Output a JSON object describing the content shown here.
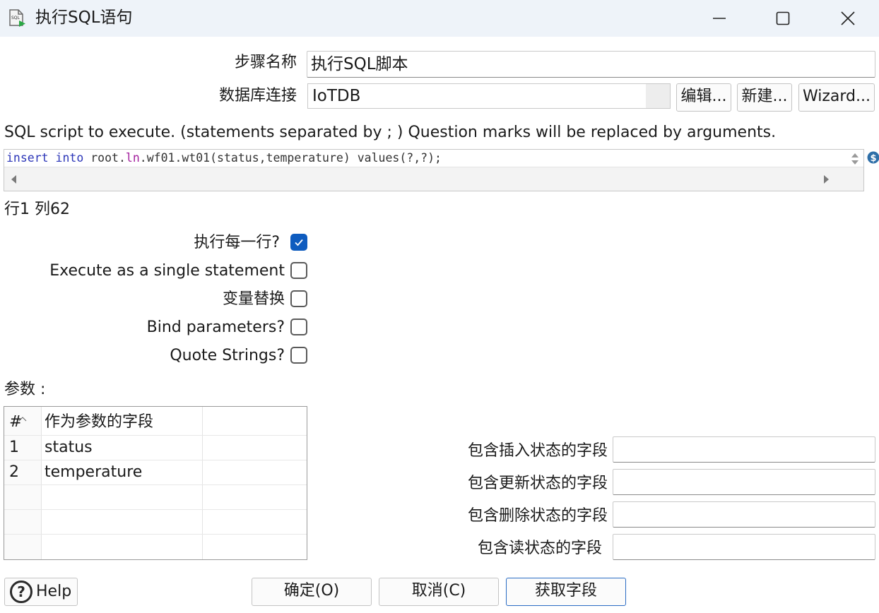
{
  "window": {
    "title": "执行SQL语句",
    "app_icon_text": "SQL"
  },
  "form": {
    "step_name_label": "步骤名称",
    "step_name_value": "执行SQL脚本",
    "db_conn_label": "数据库连接",
    "db_conn_value": "IoTDB",
    "edit_btn": "编辑...",
    "new_btn": "新建...",
    "wizard_btn": "Wizard..."
  },
  "sql": {
    "description": "SQL script to execute. (statements separated by ; ) Question marks will be replaced by arguments.",
    "code": {
      "kw_insert": "insert",
      "kw_into": "into",
      "text1": "root.",
      "kw_ln": "ln",
      "text2": ".wf01.wt01(status,temperature) values(?,?);"
    },
    "cursor_pos": "行1 列62"
  },
  "options": {
    "exec_each_row": {
      "label": "执行每一行?",
      "checked": true
    },
    "single_statement": {
      "label": "Execute as a single statement",
      "checked": false
    },
    "var_substitution": {
      "label": "变量替换",
      "checked": false
    },
    "bind_params": {
      "label": "Bind parameters?",
      "checked": false
    },
    "quote_strings": {
      "label": "Quote Strings?",
      "checked": false
    }
  },
  "params": {
    "label": "参数 :",
    "columns": [
      "#",
      "作为参数的字段"
    ],
    "rows": [
      {
        "idx": "1",
        "field": "status"
      },
      {
        "idx": "2",
        "field": "temperature"
      }
    ]
  },
  "status_fields": {
    "insert_label": "包含插入状态的字段",
    "update_label": "包含更新状态的字段",
    "delete_label": "包含删除状态的字段",
    "read_label": "包含读状态的字段"
  },
  "buttons": {
    "help": "Help",
    "ok": "确定(O)",
    "cancel": "取消(C)",
    "get_fields": "获取字段"
  }
}
